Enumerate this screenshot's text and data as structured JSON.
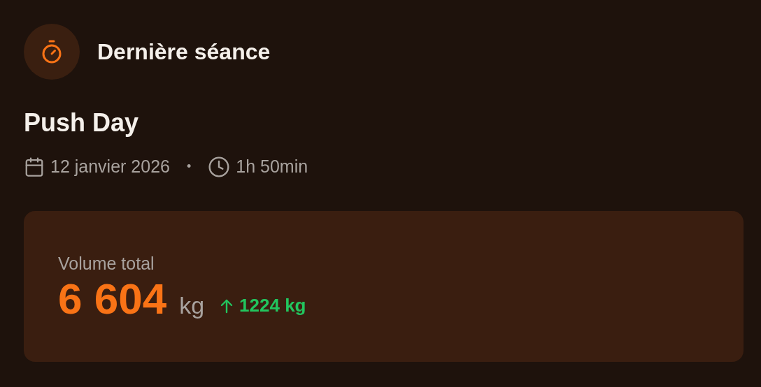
{
  "header": {
    "title": "Dernière séance"
  },
  "workout": {
    "name": "Push Day",
    "date": "12 janvier 2026",
    "separator": "•",
    "duration": "1h 50min"
  },
  "volume": {
    "label": "Volume total",
    "value": "6 604",
    "unit": "kg",
    "delta": {
      "kind": "up",
      "text": "1224 kg"
    }
  }
}
